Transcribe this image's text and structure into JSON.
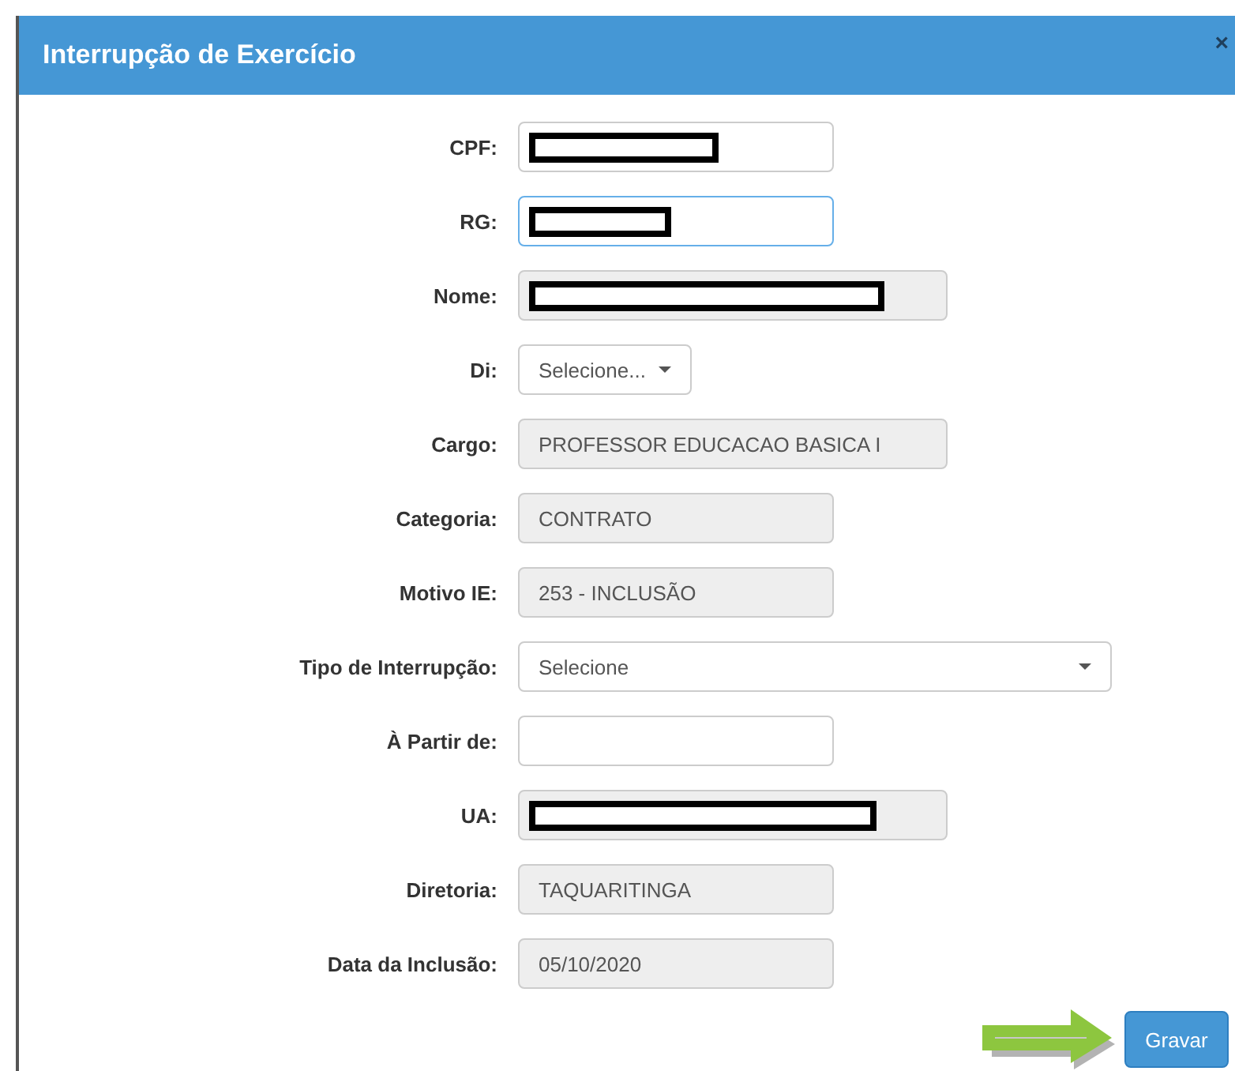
{
  "dialog": {
    "title": "Interrupção de Exercício",
    "close": "×"
  },
  "fields": [
    {
      "label": "CPF:",
      "kind": "text",
      "readonly": false,
      "focused": false,
      "redacted": true
    },
    {
      "label": "RG:",
      "kind": "text",
      "readonly": false,
      "focused": true,
      "redacted": true
    },
    {
      "label": "Nome:",
      "kind": "text",
      "readonly": true,
      "focused": false,
      "redacted": true
    },
    {
      "label": "Di:",
      "kind": "select",
      "value": "Selecione..."
    },
    {
      "label": "Cargo:",
      "kind": "text",
      "readonly": true,
      "focused": false,
      "value": "PROFESSOR EDUCACAO BASICA I"
    },
    {
      "label": "Categoria:",
      "kind": "text",
      "readonly": true,
      "focused": false,
      "value": "CONTRATO"
    },
    {
      "label": "Motivo IE:",
      "kind": "text",
      "readonly": true,
      "focused": false,
      "value": "253 - INCLUSÃO"
    },
    {
      "label": "Tipo de Interrupção:",
      "kind": "select",
      "value": "Selecione"
    },
    {
      "label": "À Partir de:",
      "kind": "text",
      "readonly": false,
      "focused": false
    },
    {
      "label": "UA:",
      "kind": "text",
      "readonly": true,
      "focused": false,
      "redacted": true
    },
    {
      "label": "Diretoria:",
      "kind": "text",
      "readonly": true,
      "focused": false,
      "value": "TAQUARITINGA"
    },
    {
      "label": "Data da Inclusão:",
      "kind": "text",
      "readonly": true,
      "focused": false,
      "value": "05/10/2020"
    }
  ],
  "buttons": [
    {
      "label": "Gravar"
    }
  ]
}
